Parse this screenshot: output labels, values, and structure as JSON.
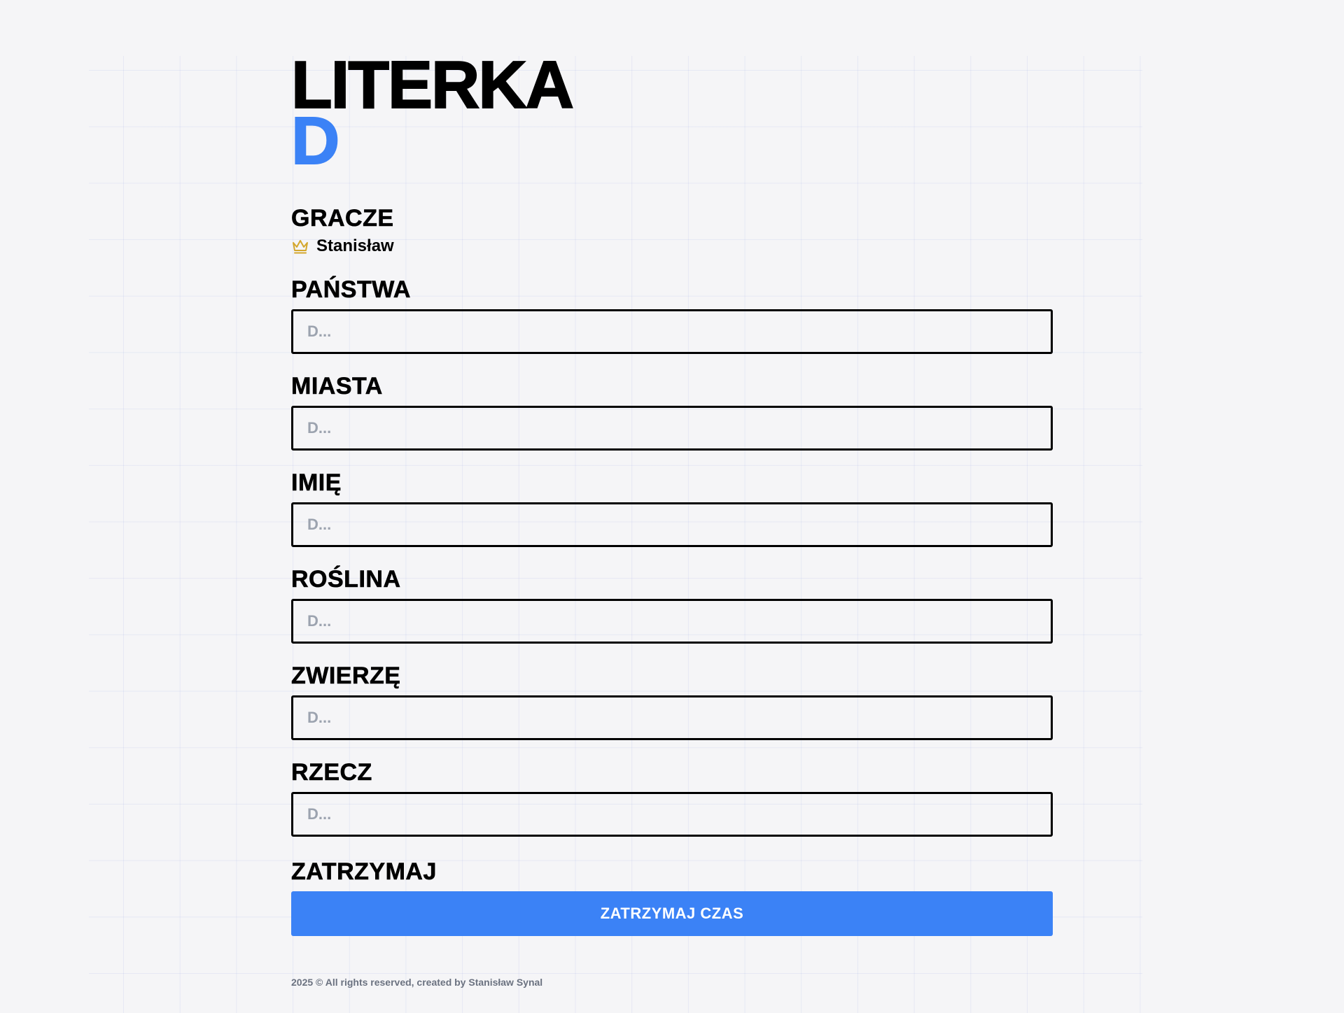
{
  "header": {
    "title": "LITERKA",
    "letter": "D"
  },
  "players": {
    "label": "GRACZE",
    "list": [
      {
        "name": "Stanisław",
        "icon": "crown-icon"
      }
    ]
  },
  "fields": [
    {
      "label": "PAŃSTWA",
      "placeholder": "D..."
    },
    {
      "label": "MIASTA",
      "placeholder": "D..."
    },
    {
      "label": "IMIĘ",
      "placeholder": "D..."
    },
    {
      "label": "ROŚLINA",
      "placeholder": "D..."
    },
    {
      "label": "ZWIERZĘ",
      "placeholder": "D..."
    },
    {
      "label": "RZECZ",
      "placeholder": "D..."
    }
  ],
  "stop": {
    "label": "ZATRZYMAJ",
    "button_label": "ZATRZYMAJ CZAS"
  },
  "footer": {
    "text": "2025 © All rights reserved, created by Stanisław Synal"
  },
  "colors": {
    "accent": "#3b82f6",
    "background": "#f5f5f7",
    "crown": "#d4a72c",
    "placeholder": "#9ca3af"
  }
}
